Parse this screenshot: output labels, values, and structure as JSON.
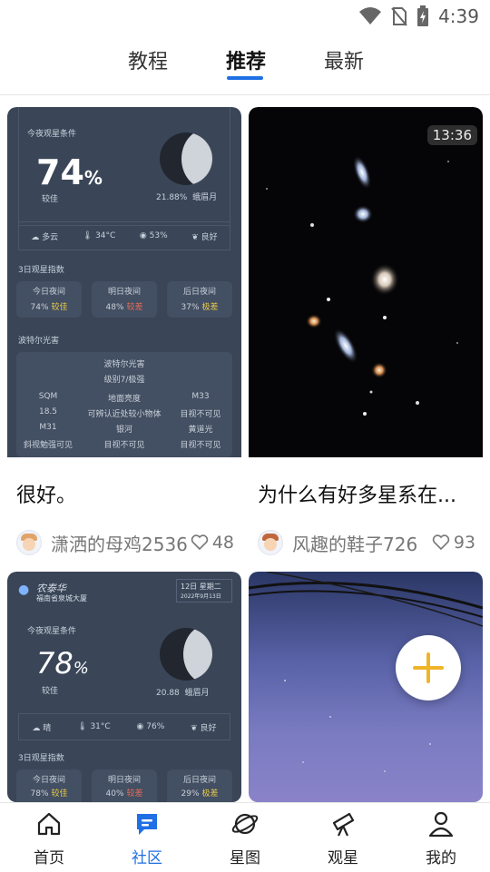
{
  "status_bar": {
    "time": "4:39",
    "icons": [
      "wifi-icon",
      "no-sim-icon",
      "battery-charging-icon"
    ]
  },
  "tabs": [
    {
      "label": "教程",
      "active": false
    },
    {
      "label": "推荐",
      "active": true
    },
    {
      "label": "最新",
      "active": false
    }
  ],
  "accent_color": "#1f6fe5",
  "cards": [
    {
      "title": "很好。",
      "author": "潇洒的母鸡2536",
      "likes": "48",
      "screenshot": {
        "heading": "今夜观星条件",
        "score": "74",
        "score_unit": "%",
        "score_grade": "较佳",
        "moon_pct": "21.88%",
        "moon_phase": "蛾眉月",
        "cloud": "多云",
        "temp": "34°C",
        "humidity": "53%",
        "air": "良好",
        "forecast_title": "3日观星指数",
        "forecast": [
          {
            "day": "今日夜间",
            "pct": "74%",
            "grade": "较佳",
            "color": "#e6c84a"
          },
          {
            "day": "明日夜间",
            "pct": "48%",
            "grade": "较差",
            "color": "#e56c5a"
          },
          {
            "day": "后日夜间",
            "pct": "37%",
            "grade": "极差",
            "color": "#e6c84a"
          }
        ],
        "bortle_title": "波特尔光害",
        "bortle_sub": "波特尔光害",
        "bortle_level": "级别7/极强",
        "grid": [
          {
            "k": "SQM",
            "v": "18.5"
          },
          {
            "k": "地面亮度",
            "v": "可辨认近处较小物体"
          },
          {
            "k": "M33",
            "v": "目视不可见"
          },
          {
            "k": "M31",
            "v": "斜视勉强可见"
          },
          {
            "k": "银河",
            "v": "目视不可见"
          },
          {
            "k": "黄道光",
            "v": "目视不可见"
          }
        ]
      }
    },
    {
      "title": "为什么有好多星系在...",
      "author": "风趣的鞋子726",
      "likes": "93",
      "duration": "13:36"
    },
    {
      "title": "",
      "screenshot": {
        "location": "农泰华",
        "location_sub": "福南省泉城大厦",
        "date_box": "12日 星期二",
        "date_box_sub": "2022年9月13日",
        "heading": "今夜观星条件",
        "score": "78",
        "score_unit": "%",
        "score_grade": "较佳",
        "moon_pct": "20.88",
        "moon_phase": "蛾眉月",
        "cloud": "晴",
        "temp": "31°C",
        "humidity": "76%",
        "air": "良好",
        "forecast_title": "3日观星指数",
        "forecast": [
          {
            "day": "今日夜间",
            "pct": "78%",
            "grade": "较佳",
            "color": "#e6c84a"
          },
          {
            "day": "明日夜间",
            "pct": "40%",
            "grade": "较差",
            "color": "#e56c5a"
          },
          {
            "day": "后日夜间",
            "pct": "29%",
            "grade": "极差",
            "color": "#e6c84a"
          }
        ]
      }
    },
    {
      "title": ""
    }
  ],
  "bottom_nav": [
    {
      "label": "首页",
      "icon": "home-icon",
      "active": false
    },
    {
      "label": "社区",
      "icon": "community-chat-icon",
      "active": true
    },
    {
      "label": "星图",
      "icon": "planet-icon",
      "active": false
    },
    {
      "label": "观星",
      "icon": "telescope-icon",
      "active": false
    },
    {
      "label": "我的",
      "icon": "profile-icon",
      "active": false
    }
  ]
}
